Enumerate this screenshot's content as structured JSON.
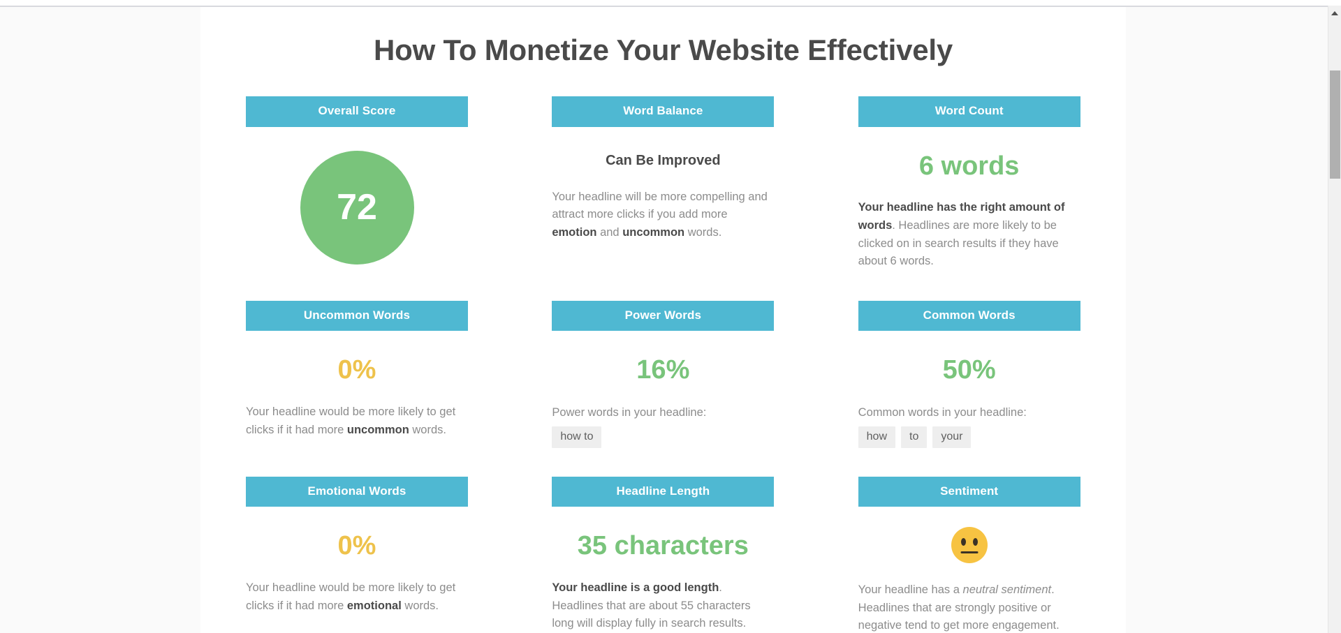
{
  "page": {
    "headline_title": "How To Monetize Your Website Effectively",
    "accent_teal": "#4FB8D2",
    "good_green": "#79C47B",
    "warn_yellow": "#EEC24B"
  },
  "cards": {
    "overall_score": {
      "header": "Overall Score",
      "score": "72"
    },
    "word_balance": {
      "header": "Word Balance",
      "verdict": "Can Be Improved",
      "desc_part1": "Your headline will be more compelling and attract more clicks if you add more ",
      "desc_bold1": "emotion",
      "desc_part2": " and ",
      "desc_bold2": "uncommon",
      "desc_part3": " words."
    },
    "word_count": {
      "header": "Word Count",
      "stat": "6 words",
      "desc_bold1": "Your headline has the right amount of words",
      "desc_part1": ". Headlines are more likely to be clicked on in search results if they have about 6 words."
    },
    "uncommon_words": {
      "header": "Uncommon Words",
      "stat": "0%",
      "desc_part1": "Your headline would be more likely to get clicks if it had more ",
      "desc_bold1": "uncommon",
      "desc_part2": " words."
    },
    "power_words": {
      "header": "Power Words",
      "stat": "16%",
      "list_label": "Power words in your headline:",
      "words": [
        "how to"
      ]
    },
    "common_words": {
      "header": "Common Words",
      "stat": "50%",
      "list_label": "Common words in your headline:",
      "words": [
        "how",
        "to",
        "your"
      ]
    },
    "emotional_words": {
      "header": "Emotional Words",
      "stat": "0%",
      "desc_part1": "Your headline would be more likely to get clicks if it had more ",
      "desc_bold1": "emotional",
      "desc_part2": " words."
    },
    "headline_length": {
      "header": "Headline Length",
      "stat": "35 characters",
      "desc_bold1": "Your headline is a good length",
      "desc_part1": ". Headlines that are about 55 characters long will display fully in search results."
    },
    "sentiment": {
      "header": "Sentiment",
      "emoji": "neutral-face-icon",
      "desc_part1": "Your headline has a ",
      "desc_italic1": "neutral sentiment",
      "desc_part2": ". Headlines that are strongly positive or negative tend to get more engagement."
    }
  },
  "scrollbar": {
    "up_arrow": "scroll-up-arrow-icon"
  }
}
